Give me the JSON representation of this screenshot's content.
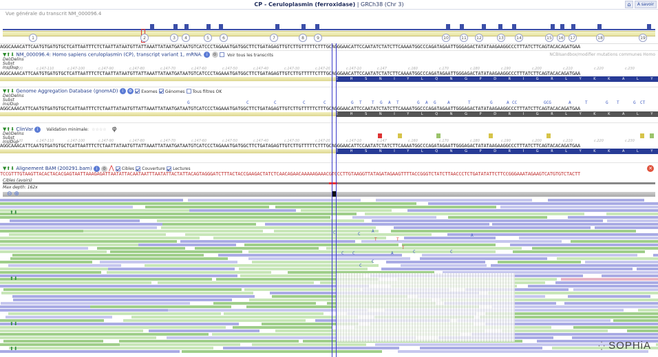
{
  "header": {
    "title_bold": "CP - Ceruloplasmin (ferroxidase)",
    "title_rest": " | GRCh38 (Chr 3)",
    "home_icon": "home-icon",
    "savoir_label": "A savoir"
  },
  "overview": {
    "label": "Vue générale du transcrit NM_000096.4",
    "exons": [
      "1",
      "2",
      "3",
      "4",
      "5",
      "6",
      "7",
      "8",
      "9",
      "10",
      "11",
      "12",
      "13",
      "14",
      "15",
      "16",
      "17",
      "18",
      "19"
    ]
  },
  "sequence": {
    "ref": "AGGCAAACATTCAATGTGATGTGCTCATTAATTTCTCTAATTATAATGTTATTAAATTATAATGATAATGTCATCCCTAGAAATGATGGCTTCTGATAGAGTTGTCTTGTTTTTCTTTGCAGGGAACATTCCAATATCTATCTTCAAAATGGCCCAGATAGAATTGGGAGACTATATAAGAAGGCCCTTTATCTTCAGTACACAGATGAA",
    "coords": [
      "c.147-120",
      "c.147-110",
      "c.147-100",
      "c.147-90",
      "c.147-80",
      "c.147-70",
      "c.147-60",
      "c.147-50",
      "c.147-40",
      "c.147-30",
      "c.147-20",
      "c.147-10",
      "c.147",
      "c.160",
      "c.170",
      "c.180",
      "c.190",
      "c.200",
      "c.210",
      "c.220",
      "c.230"
    ],
    "aa": "E H S N I Y L Q N G P D R I G R L Y K K A L Y L Q Y T D E"
  },
  "tracks": {
    "refseq": {
      "title": "NM_000096.4: Homo sapiens ceruloplasmin (CP), transcript variant 1, mRNA.",
      "checkbox_label": "Voir tous les transcrits",
      "labels": [
        "Del/Delins",
        "Subst",
        "Ins/Dup"
      ],
      "right_note": "NCBIsandbox/modifier mutations communes Homo"
    },
    "gnomad": {
      "title": "Genome Aggregation Database (gnomAD)",
      "checks": [
        "Exomes",
        "Génomes",
        "Tous filtres OK"
      ],
      "labels": [
        "Del/Delins",
        "Subst",
        "Ins/Dup"
      ],
      "letters": [
        "G",
        "C",
        "C",
        "C",
        "C",
        "G",
        "T",
        "T",
        "G",
        "A",
        "T",
        "G",
        "A",
        "G",
        "A",
        "T",
        "G",
        "A",
        "CC",
        "GCG",
        "A",
        "T",
        "G",
        "T",
        "G",
        "CT"
      ]
    },
    "clinvar": {
      "title": "ClinVar",
      "validation_label": "Validation minimale:",
      "stars": "☆☆☆☆",
      "phi": "φ",
      "labels": [
        "Del/Delins",
        "Subst",
        "Ins/Dup"
      ]
    },
    "bam": {
      "title": "Alignement BAM (200291.bam)",
      "checks": [
        "Cibles",
        "Couverture",
        "Lectures"
      ],
      "seq": "TCCGTTTGTAAGTTACACTACACGAGTAATTAAAGAGATTAATATTACAATAATTTAATATTACTATTACAGTAGGGATCTTTACTACCGAAGACTATCTCAACAGAACAAAAAGAAACGTCCCTTGTAAGGTTATAGATAGAAGTTTTACCGGGTCTATCTTAACCCTCTGATATATTCTTCCGGGAAATAGAAGTCATGTGTCTACTT",
      "cibles_label": "Cibles (avoirs)",
      "max_depth": "Max depth: 162x"
    }
  },
  "logo": "SOPHiA",
  "colors": {
    "accent": "#273b96",
    "cursor": "#3b3bc9",
    "read_forward": "#c8e6b8",
    "read_reverse": "#c6c7ee"
  }
}
